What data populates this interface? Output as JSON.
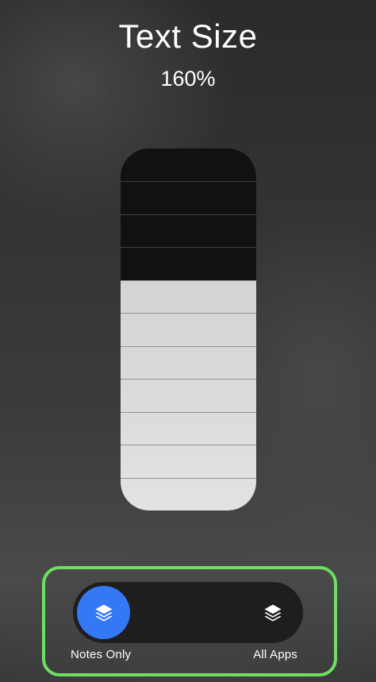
{
  "header": {
    "title": "Text Size",
    "value_text": "160%"
  },
  "slider": {
    "total_steps": 11,
    "filled_steps": 7,
    "fill_color": "#dddddd",
    "track_color": "#111111"
  },
  "scope": {
    "options": [
      {
        "label": "Notes Only",
        "icon": "layers-icon",
        "selected": true
      },
      {
        "label": "All Apps",
        "icon": "layers-icon",
        "selected": false
      }
    ],
    "selected_color": "#3478f6",
    "highlight_color": "#6ee061"
  }
}
